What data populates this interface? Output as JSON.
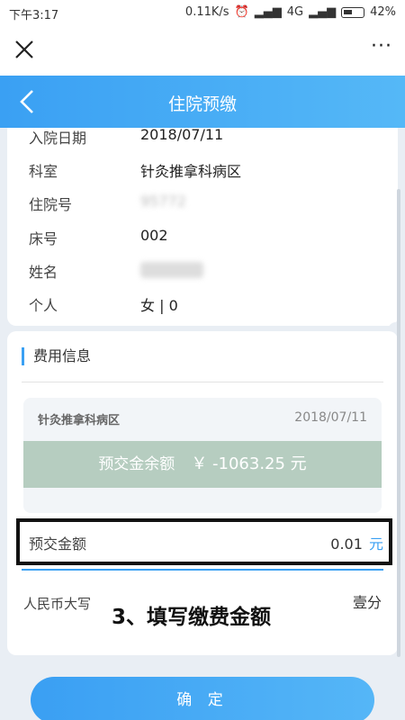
{
  "status_bar": {
    "time": "下午3:17",
    "network_speed": "0.11K/s",
    "network": "4G",
    "battery": "42%"
  },
  "nav": {
    "close_icon": "close-icon",
    "more_label": "···"
  },
  "header": {
    "title": "住院预缴"
  },
  "info": {
    "rows": [
      {
        "label": "入院日期",
        "value": "2018/07/11"
      },
      {
        "label": "科室",
        "value": "针灸推拿科病区"
      },
      {
        "label": "住院号",
        "value": "95772"
      },
      {
        "label": "床号",
        "value": "002"
      },
      {
        "label": "姓名",
        "value": ""
      },
      {
        "label": "个人",
        "value": "女 | 0"
      }
    ]
  },
  "fee": {
    "section_title": "费用信息",
    "ward_name": "针灸推拿科病区",
    "ward_date": "2018/07/11",
    "balance_label": "预交金余额",
    "balance_value": "￥ -1063.25 元",
    "amount_label": "预交金额",
    "amount_value": "0.01",
    "amount_unit": "元",
    "rmb_label": "人民币大写",
    "rmb_value": "壹分",
    "annotation": "3、填写缴费金额"
  },
  "confirm_label": "确 定",
  "colors": {
    "accent": "#3aa0f3",
    "balance_bg": "#b6cdc0"
  }
}
